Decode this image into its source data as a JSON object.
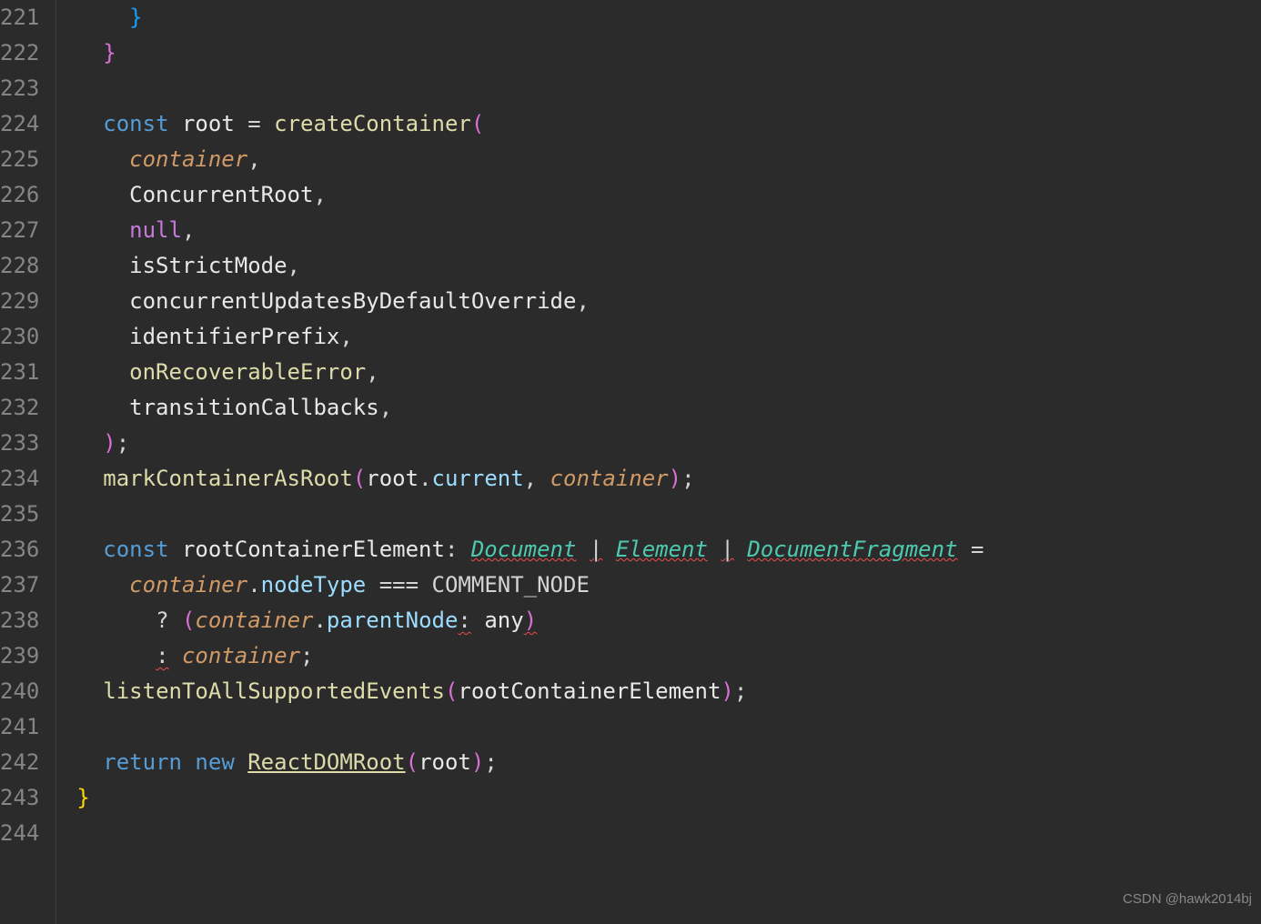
{
  "lineNumbers": [
    "221",
    "222",
    "223",
    "224",
    "225",
    "226",
    "227",
    "228",
    "229",
    "230",
    "231",
    "232",
    "233",
    "234",
    "235",
    "236",
    "237",
    "238",
    "239",
    "240",
    "241",
    "242",
    "243",
    "244"
  ],
  "code": {
    "l221": {
      "brace": "}"
    },
    "l222": {
      "brace": "}"
    },
    "l224": {
      "const": "const",
      "root": "root",
      "eq": "=",
      "fn": "createContainer",
      "paren": "("
    },
    "l225": {
      "param": "container",
      "comma": ","
    },
    "l226": {
      "var": "ConcurrentRoot",
      "comma": ","
    },
    "l227": {
      "null": "null",
      "comma": ","
    },
    "l228": {
      "var": "isStrictMode",
      "comma": ","
    },
    "l229": {
      "var": "concurrentUpdatesByDefaultOverride",
      "comma": ","
    },
    "l230": {
      "var": "identifierPrefix",
      "comma": ","
    },
    "l231": {
      "var": "onRecoverableError",
      "comma": ","
    },
    "l232": {
      "var": "transitionCallbacks",
      "comma": ","
    },
    "l233": {
      "paren": ")",
      "semi": ";"
    },
    "l234": {
      "fn": "markContainerAsRoot",
      "lp": "(",
      "root": "root",
      "dot": ".",
      "cur": "current",
      "comma": ",",
      "sp": " ",
      "param": "container",
      "rp": ")",
      "semi": ";"
    },
    "l236": {
      "const": "const",
      "var": "rootContainerElement",
      "colon": ":",
      "t1": "Document",
      "pipe": "|",
      "t2": "Element",
      "t3": "DocumentFragment",
      "eq": "="
    },
    "l237": {
      "param": "container",
      "dot": ".",
      "prop": "nodeType",
      "op": "===",
      "const2": "COMMENT_NODE"
    },
    "l238": {
      "q": "?",
      "lp": "(",
      "param": "container",
      "dot": ".",
      "prop": "parentNode",
      "colon": ":",
      "any": "any",
      "rp": ")"
    },
    "l239": {
      "colon": ":",
      "param": "container",
      "semi": ";"
    },
    "l240": {
      "fn": "listenToAllSupportedEvents",
      "lp": "(",
      "var": "rootContainerElement",
      "rp": ")",
      "semi": ";"
    },
    "l242": {
      "ret": "return",
      "new": "new",
      "cls": "ReactDOMRoot",
      "lp": "(",
      "var": "root",
      "rp": ")",
      "semi": ";"
    },
    "l243": {
      "brace": "}"
    }
  },
  "watermark": "CSDN @hawk2014bj"
}
